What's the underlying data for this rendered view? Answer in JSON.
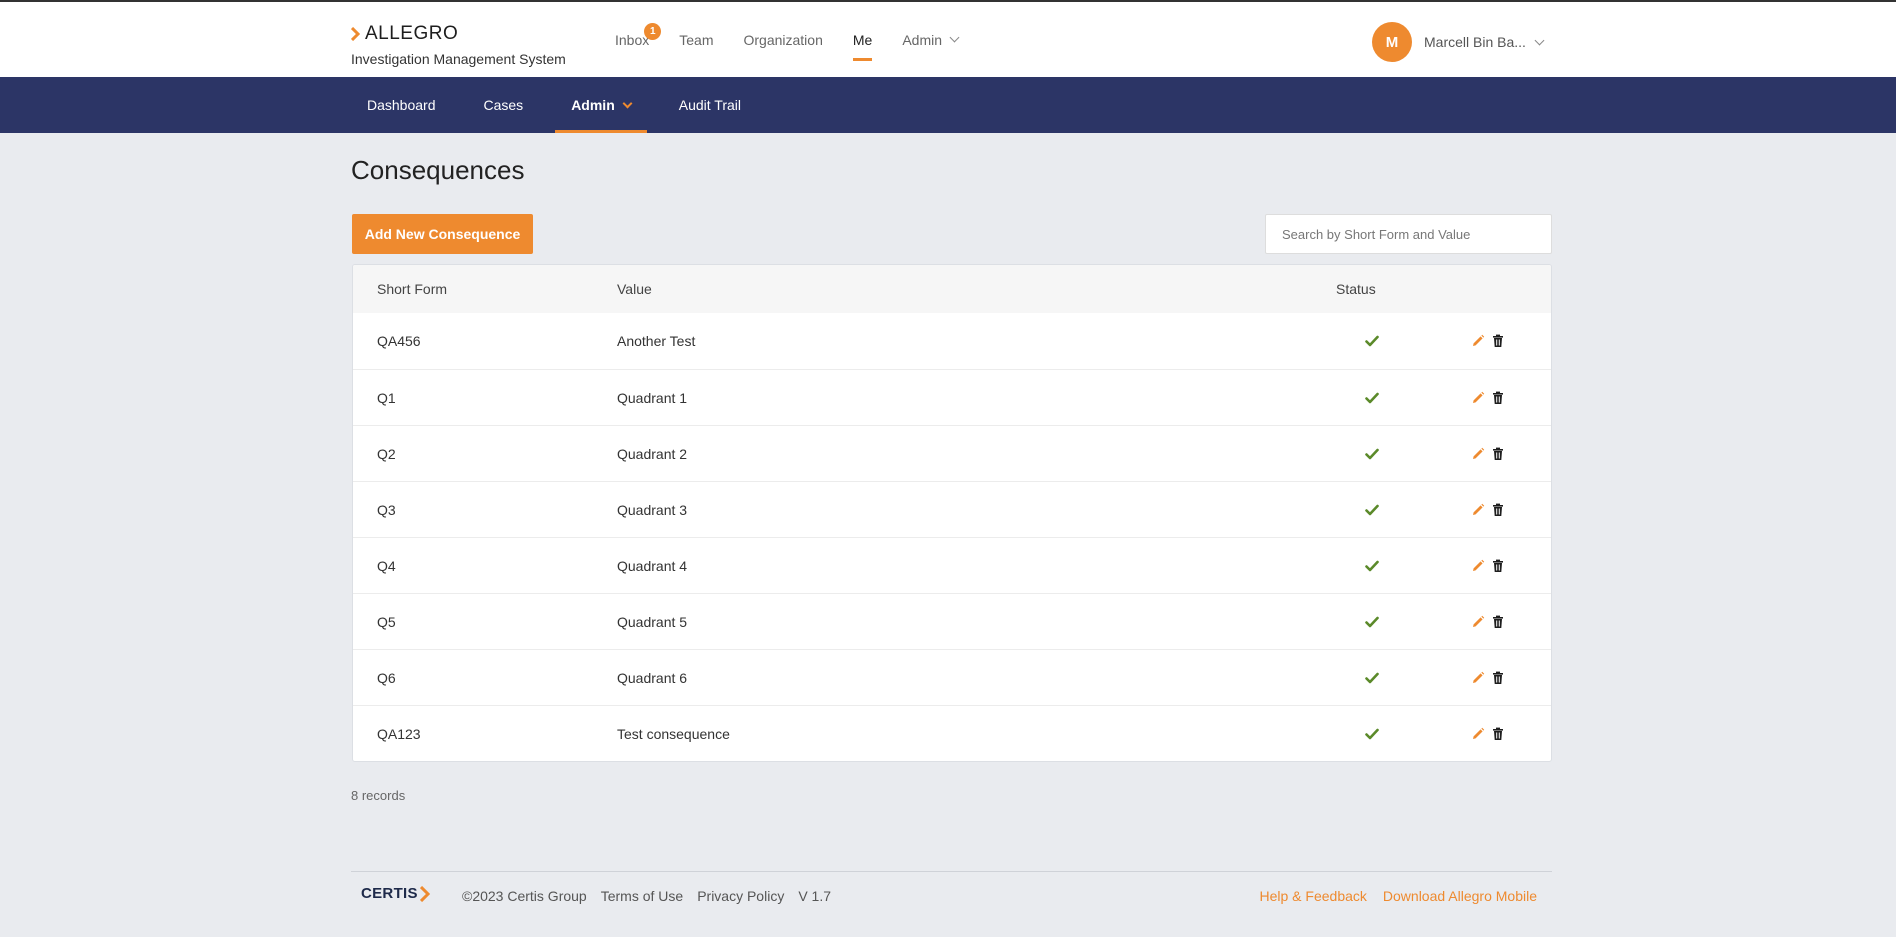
{
  "app": {
    "logo_text": "ALLEGRO",
    "subtitle": "Investigation Management System"
  },
  "topnav": {
    "items": [
      {
        "label": "Inbox",
        "badge": "1"
      },
      {
        "label": "Team"
      },
      {
        "label": "Organization"
      },
      {
        "label": "Me",
        "active": true
      },
      {
        "label": "Admin"
      }
    ]
  },
  "user": {
    "initial": "M",
    "name": "Marcell Bin Ba..."
  },
  "subnav": {
    "items": [
      {
        "label": "Dashboard"
      },
      {
        "label": "Cases"
      },
      {
        "label": "Admin",
        "active": true
      },
      {
        "label": "Audit Trail"
      }
    ]
  },
  "page": {
    "title": "Consequences",
    "add_button": "Add New Consequence",
    "search_placeholder": "Search by Short Form and Value"
  },
  "table": {
    "headers": {
      "short_form": "Short Form",
      "value": "Value",
      "status": "Status"
    },
    "rows": [
      {
        "short_form": "QA456",
        "value": "Another Test",
        "active": true
      },
      {
        "short_form": "Q1",
        "value": "Quadrant 1",
        "active": true
      },
      {
        "short_form": "Q2",
        "value": "Quadrant 2",
        "active": true
      },
      {
        "short_form": "Q3",
        "value": "Quadrant 3",
        "active": true
      },
      {
        "short_form": "Q4",
        "value": "Quadrant 4",
        "active": true
      },
      {
        "short_form": "Q5",
        "value": "Quadrant 5",
        "active": true
      },
      {
        "short_form": "Q6",
        "value": "Quadrant 6",
        "active": true
      },
      {
        "short_form": "QA123",
        "value": "Test consequence",
        "active": true
      }
    ]
  },
  "records_text": "8 records",
  "footer": {
    "brand": "CERTIS",
    "copyright": "©2023 Certis Group",
    "terms": "Terms of Use",
    "privacy": "Privacy Policy",
    "version": "V 1.7",
    "help": "Help & Feedback",
    "download": "Download Allegro Mobile"
  },
  "colors": {
    "accent": "#ee8a2f",
    "navbar": "#2c3566",
    "success": "#5b8a2a"
  },
  "icons": {
    "status": "check-icon",
    "edit": "pencil-icon",
    "delete": "trash-icon"
  }
}
